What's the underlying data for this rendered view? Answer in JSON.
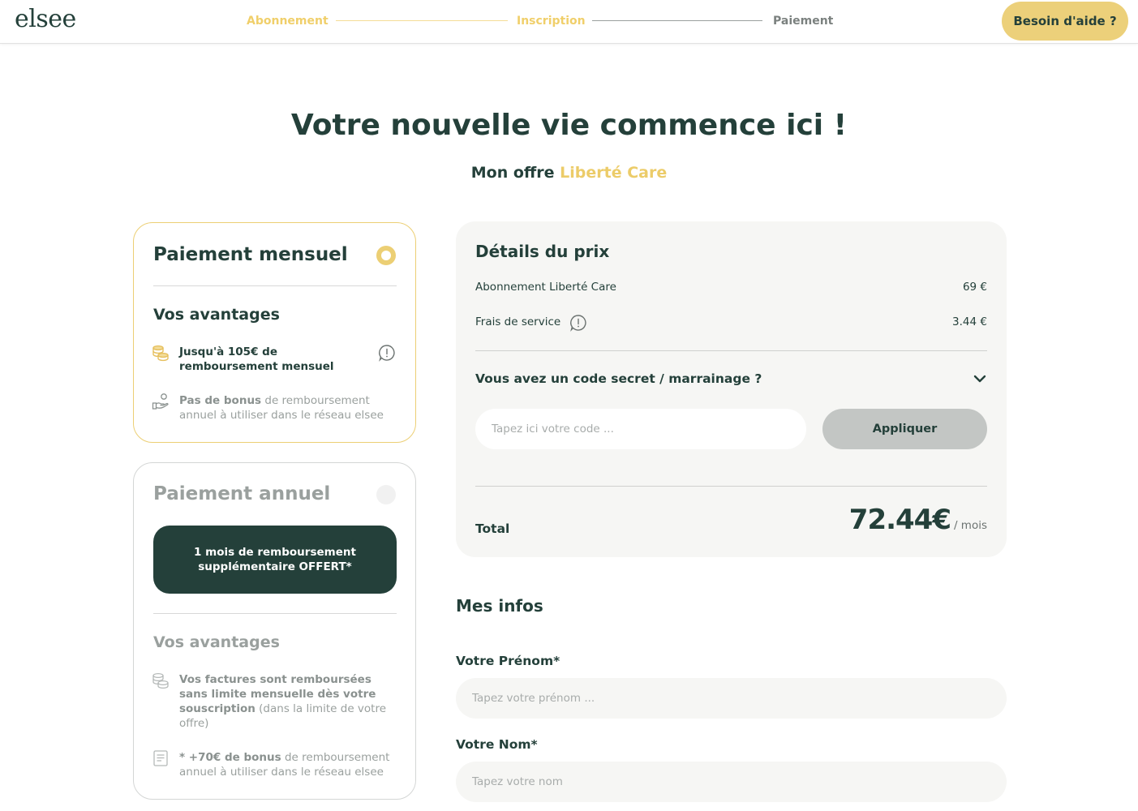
{
  "header": {
    "logo": "elsee",
    "steps": [
      {
        "label": "Abonnement",
        "state": "done"
      },
      {
        "label": "Inscription",
        "state": "done"
      },
      {
        "label": "Paiement",
        "state": "upcoming"
      }
    ],
    "help_label": "Besoin d'aide ?"
  },
  "hero": {
    "title": "Votre nouvelle vie commence ici !",
    "subtitle_prefix": "Mon offre",
    "offer_name": "Liberté Care"
  },
  "plans": {
    "monthly": {
      "title": "Paiement mensuel",
      "selected": true,
      "advantages_title": "Vos avantages",
      "perk1": "Jusqu'à 105€ de remboursement mensuel",
      "perk2_strong": "Pas de bonus",
      "perk2_rest": " de remboursement annuel à utiliser dans le réseau elsee"
    },
    "annual": {
      "title": "Paiement annuel",
      "selected": false,
      "offer_banner": "1 mois de remboursement supplémentaire OFFERT*",
      "advantages_title": "Vos avantages",
      "perk1_strong": "Vos factures sont remboursées sans limite mensuelle dès votre souscription",
      "perk1_rest": " (dans la limite de votre offre)",
      "perk2_strong": "* +70€ de bonus",
      "perk2_rest": " de remboursement annuel à utiliser dans le réseau elsee"
    }
  },
  "price": {
    "title": "Détails du prix",
    "rows": [
      {
        "label": "Abonnement Liberté Care",
        "value": "69 €"
      },
      {
        "label": "Frais de service",
        "value": "3.44 €"
      }
    ],
    "promo_label": "Vous avez un code secret / marrainage ?",
    "code_placeholder": "Tapez ici votre code ...",
    "apply_label": "Appliquer",
    "total_label": "Total",
    "total_amount": "72.44€",
    "total_suffix": "/ mois"
  },
  "infos": {
    "title": "Mes infos",
    "firstname_label": "Votre Prénom*",
    "firstname_placeholder": "Tapez votre prénom ...",
    "lastname_label": "Votre Nom*",
    "lastname_placeholder": "Tapez votre nom"
  },
  "colors": {
    "primary": "#24403a",
    "accent": "#eccf74",
    "panel_bg": "#f6f6f4",
    "muted": "#9aa09e"
  }
}
